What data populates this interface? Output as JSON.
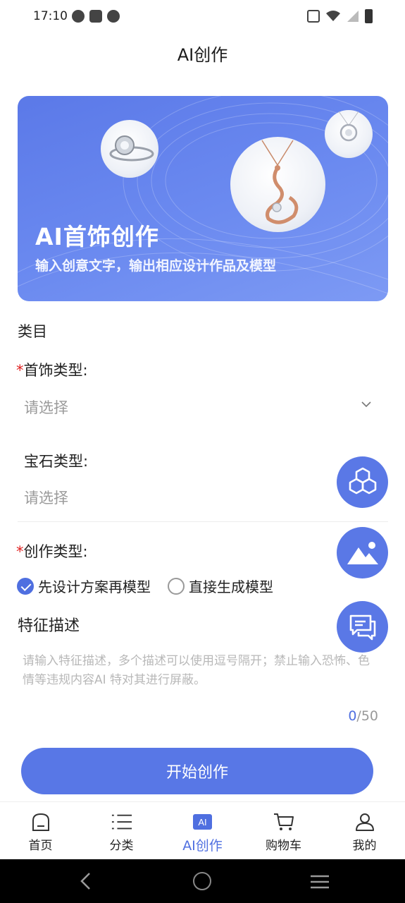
{
  "status_bar": {
    "time": "17:10"
  },
  "header": {
    "title": "AI创作"
  },
  "banner": {
    "title": "AI首饰创作",
    "subtitle": "输入创意文字，输出相应设计作品及模型"
  },
  "form": {
    "section_label": "类目",
    "jewelry_type": {
      "required_mark": "*",
      "label": "首饰类型:",
      "value": "请选择"
    },
    "gem_type": {
      "label": "宝石类型:",
      "value": "请选择"
    },
    "creation_type": {
      "required_mark": "*",
      "label": "创作类型:",
      "options": [
        {
          "label": "先设计方案再模型",
          "checked": true
        },
        {
          "label": "直接生成模型",
          "checked": false
        }
      ]
    },
    "feature": {
      "label": "特征描述",
      "placeholder": "请输入特征描述，多个描述可以使用逗号隔开；禁止输入恐怖、色情等违规内容AI 特对其进行屏蔽。",
      "value": "",
      "count_current": "0",
      "count_max": "/50"
    },
    "submit_label": "开始创作"
  },
  "tabs": [
    {
      "label": "首页",
      "icon": "home-icon",
      "active": false
    },
    {
      "label": "分类",
      "icon": "list-icon",
      "active": false
    },
    {
      "label": "AI创作",
      "icon": "ai-icon",
      "active": true,
      "icon_text": "AI"
    },
    {
      "label": "购物车",
      "icon": "cart-icon",
      "active": false
    },
    {
      "label": "我的",
      "icon": "user-icon",
      "active": false
    }
  ],
  "colors": {
    "accent": "#4f6fe0",
    "required": "#e02020",
    "placeholder": "#9a9a9a"
  }
}
